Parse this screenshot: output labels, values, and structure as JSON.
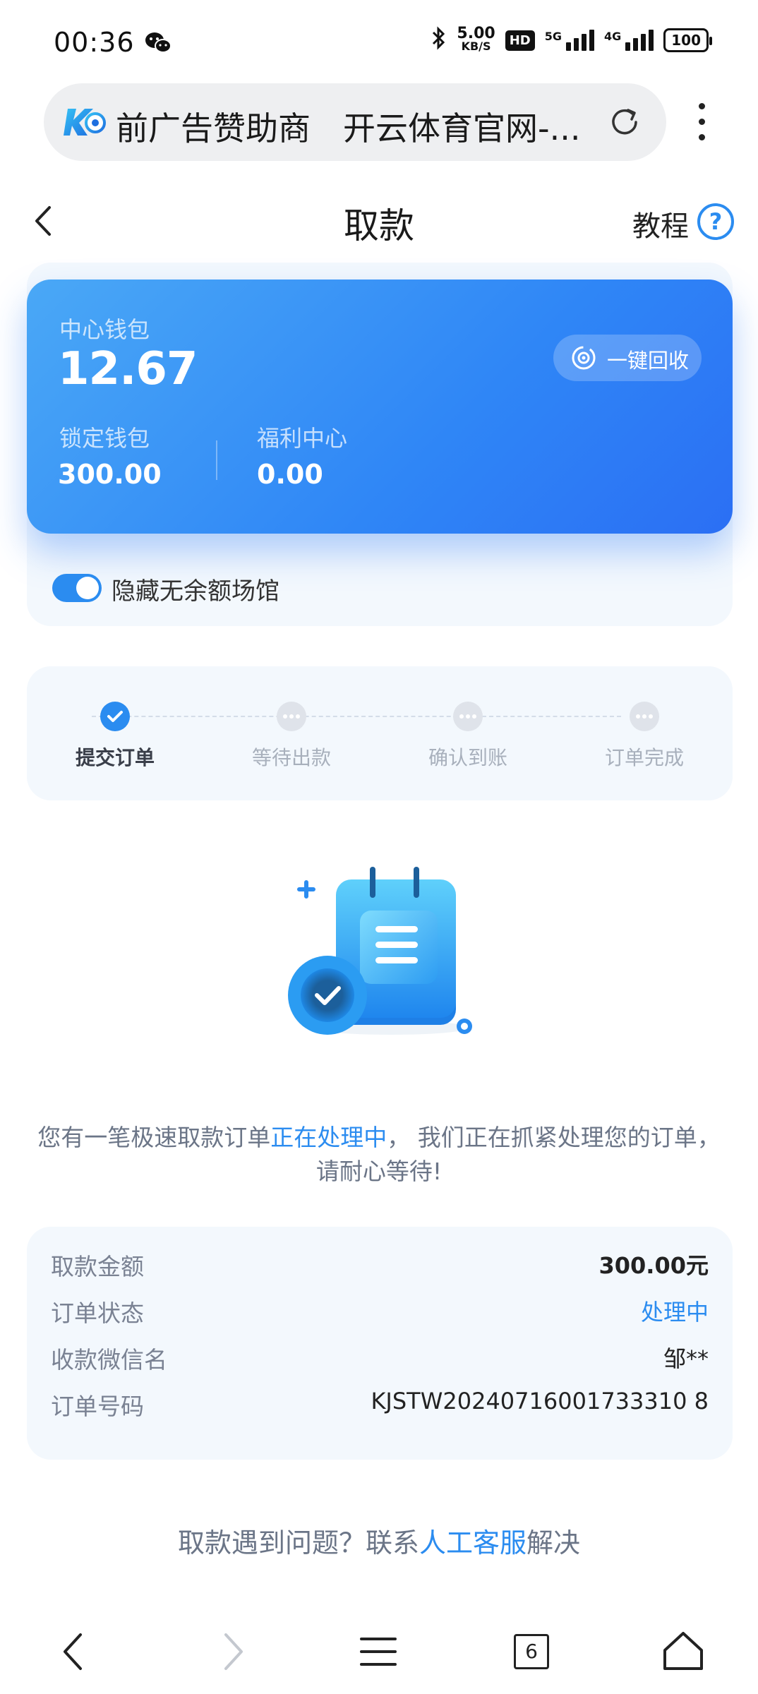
{
  "status_bar": {
    "time": "00:36",
    "net_speed_value": "5.00",
    "net_speed_unit": "KB/S",
    "hd_badge": "HD",
    "signal1_label": "5G",
    "signal2_label": "4G",
    "battery": "100",
    "icons": [
      "wechat-icon",
      "bluetooth-icon",
      "signal-icon",
      "battery-icon"
    ]
  },
  "browser": {
    "url_title": "前广告赞助商　开云体育官网-...",
    "tab_count": "6",
    "icons": [
      "site-logo-icon",
      "reload-icon",
      "more-icon"
    ]
  },
  "header": {
    "title": "取款",
    "tutorial_label": "教程",
    "help_icon_text": "?"
  },
  "wallet": {
    "center_label": "中心钱包",
    "center_value": "12.67",
    "locked_label": "锁定钱包",
    "locked_value": "300.00",
    "welfare_label": "福利中心",
    "welfare_value": "0.00",
    "recycle_label": "一键回收"
  },
  "toggle": {
    "label": "隐藏无余额场馆",
    "on": true
  },
  "steps": [
    {
      "label": "提交订单",
      "state": "done"
    },
    {
      "label": "等待出款",
      "state": "pending"
    },
    {
      "label": "确认到账",
      "state": "pending"
    },
    {
      "label": "订单完成",
      "state": "pending"
    }
  ],
  "message": {
    "part1": "您有一笔极速取款订单",
    "highlight": "正在处理中",
    "part2": "， 我们正在抓紧处理您的订单，",
    "line2": "请耐心等待!"
  },
  "details": {
    "amount_label": "取款金额",
    "amount_value": "300.00元",
    "status_label": "订单状态",
    "status_value": "处理中",
    "wechat_name_label": "收款微信名",
    "wechat_name_value": "邹**",
    "order_no_label": "订单号码",
    "order_no_value": "KJSTW20240716001733310 8"
  },
  "help": {
    "prefix": "取款遇到问题？联系",
    "link": "人工客服",
    "suffix": "解决"
  },
  "colors": {
    "accent": "#2b8cf0",
    "card_gradient_start": "#4aa8f6",
    "card_gradient_end": "#2b6ff4",
    "panel_bg": "#f3f8fd"
  }
}
